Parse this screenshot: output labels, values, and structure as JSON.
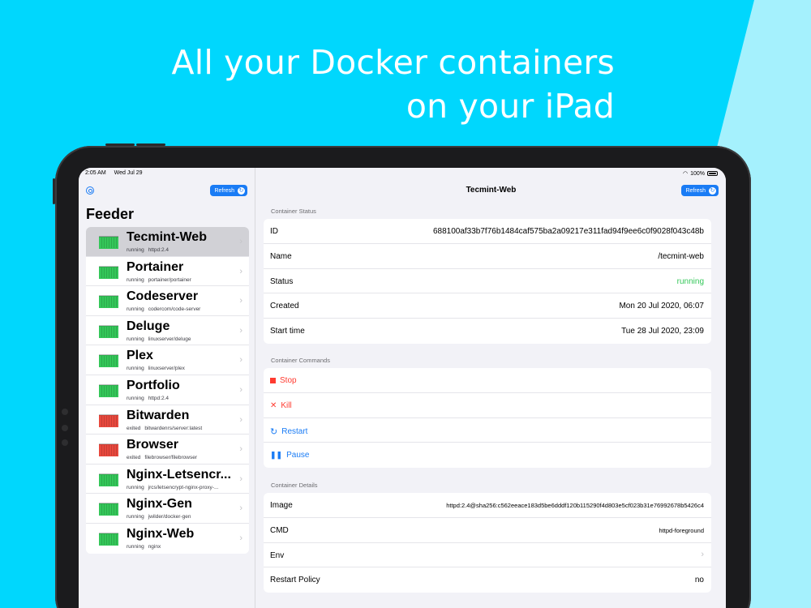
{
  "headline": {
    "line1": "All your Docker containers",
    "line2": "on your iPad"
  },
  "status_bar": {
    "time": "2:05 AM",
    "date": "Wed Jul 29",
    "battery": "100%"
  },
  "sidebar": {
    "refresh_label": "Refresh",
    "title": "Feeder",
    "items": [
      {
        "name": "Tecmint-Web",
        "state": "running",
        "image": "httpd:2.4",
        "color": "#34c759"
      },
      {
        "name": "Portainer",
        "state": "running",
        "image": "portainer/portainer",
        "color": "#34c759"
      },
      {
        "name": "Codeserver",
        "state": "running",
        "image": "codercom/code-server",
        "color": "#34c759"
      },
      {
        "name": "Deluge",
        "state": "running",
        "image": "linuxserver/deluge",
        "color": "#34c759"
      },
      {
        "name": "Plex",
        "state": "running",
        "image": "linuxserver/plex",
        "color": "#34c759"
      },
      {
        "name": "Portfolio",
        "state": "running",
        "image": "httpd:2.4",
        "color": "#34c759"
      },
      {
        "name": "Bitwarden",
        "state": "exited",
        "image": "bitwardenrs/server:latest",
        "color": "#e8483d"
      },
      {
        "name": "Browser",
        "state": "exited",
        "image": "filebrowser/filebrowser",
        "color": "#e8483d"
      },
      {
        "name": "Nginx-Letsencr...",
        "state": "running",
        "image": "jrcs/letsencrypt-nginx-proxy-...",
        "color": "#34c759"
      },
      {
        "name": "Nginx-Gen",
        "state": "running",
        "image": "jwilder/docker-gen",
        "color": "#34c759"
      },
      {
        "name": "Nginx-Web",
        "state": "running",
        "image": "nginx",
        "color": "#34c759"
      }
    ]
  },
  "detail": {
    "title": "Tecmint-Web",
    "refresh_label": "Refresh",
    "status_section": "Container Status",
    "status_rows": [
      {
        "key": "ID",
        "value": "688100af33b7f76b1484caf575ba2a09217e311fad94f9ee6c0f9028f043c48b"
      },
      {
        "key": "Name",
        "value": "/tecmint-web"
      },
      {
        "key": "Status",
        "value": "running"
      },
      {
        "key": "Created",
        "value": "Mon 20 Jul 2020, 06:07"
      },
      {
        "key": "Start time",
        "value": "Tue 28 Jul 2020, 23:09"
      }
    ],
    "commands_section": "Container Commands",
    "commands": {
      "stop": "Stop",
      "kill": "Kill",
      "restart": "Restart",
      "pause": "Pause"
    },
    "details_section": "Container Details",
    "detail_rows": [
      {
        "key": "Image",
        "value": "httpd:2.4@sha256:c562eeace183d5be6dddf120b115290f4d803e5cf023b31e76992678b5426c4"
      },
      {
        "key": "CMD",
        "value": "httpd-foreground"
      },
      {
        "key": "Env",
        "value": ""
      },
      {
        "key": "Restart Policy",
        "value": "no"
      }
    ]
  },
  "colors": {
    "background": "#00d7fd",
    "accent": "#1a7cf5",
    "running": "#34c759",
    "stop": "#ff3b30"
  }
}
